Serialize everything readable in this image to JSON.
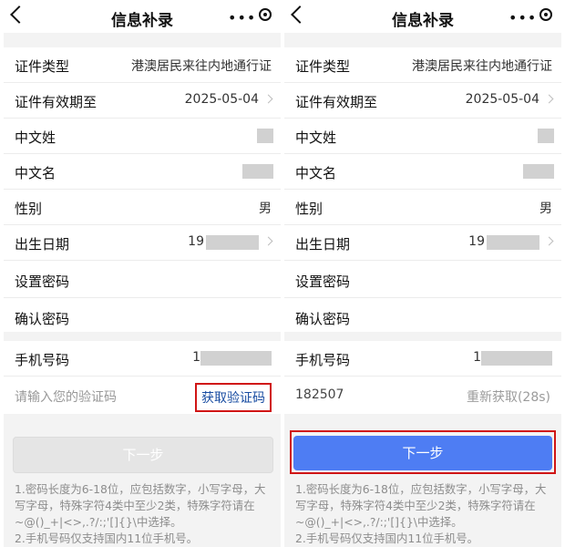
{
  "nav": {
    "title": "信息补录",
    "more_label": "•••"
  },
  "fields": {
    "doc_type_label": "证件类型",
    "doc_type_value": "港澳居民来往内地通行证",
    "validity_label": "证件有效期至",
    "validity_value": "2025-05-04",
    "surname_label": "中文姓",
    "givenname_label": "中文名",
    "gender_label": "性别",
    "gender_value": "男",
    "birth_label": "出生日期",
    "birth_value": "19",
    "set_password_label": "设置密码",
    "confirm_password_label": "确认密码",
    "phone_label": "手机号码",
    "phone_value": "1"
  },
  "left": {
    "code_placeholder": "请输入您的验证码",
    "get_code_label": "获取验证码",
    "next_label": "下一步"
  },
  "right": {
    "code_value": "182507",
    "resend_label": "重新获取(28s)",
    "next_label": "下一步"
  },
  "notes": {
    "line1": "1.密码长度为6-18位，应包括数字，小写字母，大写字母，特殊字符4类中至少2类，特殊字符请在~@()_+|<>,.?/:;'[]{}\\中选择。",
    "line2": "2.手机号码仅支持国内11位手机号。"
  }
}
